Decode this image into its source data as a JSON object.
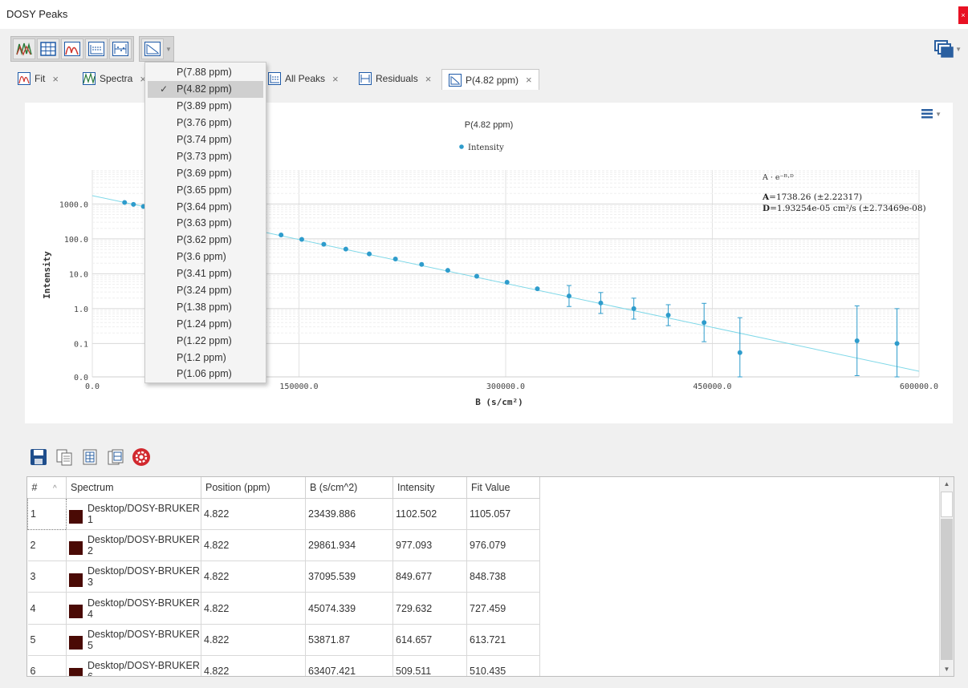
{
  "window": {
    "title": "DOSY Peaks",
    "close_label": "×"
  },
  "toolbar": {
    "buttons": [
      "spectra-view-icon",
      "table-icon",
      "fit-curve-icon",
      "all-peaks-icon",
      "residuals-icon"
    ],
    "plot_dropdown_icon": "log-plot-icon"
  },
  "tabs": [
    {
      "label": "Fit",
      "close": "×"
    },
    {
      "label": "Spectra",
      "close": "×"
    },
    {
      "label": "All Peaks",
      "close": "×"
    },
    {
      "label": "Residuals",
      "close": "×"
    },
    {
      "label": "P(4.82 ppm)",
      "close": "×",
      "active": true
    }
  ],
  "dropdown": {
    "check_mark": "✓",
    "items": [
      "P(7.88 ppm)",
      "P(4.82 ppm)",
      "P(3.89 ppm)",
      "P(3.76 ppm)",
      "P(3.74 ppm)",
      "P(3.73 ppm)",
      "P(3.69 ppm)",
      "P(3.65 ppm)",
      "P(3.64 ppm)",
      "P(3.63 ppm)",
      "P(3.62 ppm)",
      "P(3.6 ppm)",
      "P(3.41 ppm)",
      "P(3.24 ppm)",
      "P(1.38 ppm)",
      "P(1.24 ppm)",
      "P(1.22 ppm)",
      "P(1.2 ppm)",
      "P(1.06 ppm)"
    ],
    "selected_index": 1
  },
  "chart_data": {
    "type": "scatter",
    "title": "P(4.82 ppm)",
    "legend": "Intensity",
    "legend_placement": "top-center",
    "xlabel": "B (s/cm²)",
    "ylabel": "Intensity",
    "xlim": [
      0,
      600000
    ],
    "y_scale": "log",
    "grid": true,
    "x_ticks": [
      "0.0",
      "150000.0",
      "300000.0",
      "450000.0",
      "600000.0"
    ],
    "y_ticks": [
      "0.0",
      "0.1",
      "1.0",
      "10.0",
      "100.0",
      "1000.0"
    ],
    "equation": "A · e⁻ᴮ·ᴰ",
    "param_A_label": "A",
    "param_A_value": "=1738.26 (±2.22317)",
    "param_D_label": "D",
    "param_D_value": "=1.93254e-05 cm²/s (±2.73469e-08)",
    "points": [
      {
        "x": 23440,
        "y": 1102.5
      },
      {
        "x": 29862,
        "y": 977.1
      },
      {
        "x": 37096,
        "y": 849.7
      },
      {
        "x": 45074,
        "y": 729.6
      },
      {
        "x": 53872,
        "y": 614.7
      },
      {
        "x": 63407,
        "y": 509.5
      },
      {
        "x": 137000,
        "y": 130
      },
      {
        "x": 152000,
        "y": 97
      },
      {
        "x": 168000,
        "y": 70
      },
      {
        "x": 184000,
        "y": 51
      },
      {
        "x": 201000,
        "y": 37
      },
      {
        "x": 220000,
        "y": 26.5
      },
      {
        "x": 239000,
        "y": 18.5
      },
      {
        "x": 258000,
        "y": 12.5
      },
      {
        "x": 279000,
        "y": 8.5
      },
      {
        "x": 301000,
        "y": 5.7
      },
      {
        "x": 323000,
        "y": 3.7
      },
      {
        "x": 346000,
        "y": 2.3
      },
      {
        "x": 369000,
        "y": 1.45
      },
      {
        "x": 393000,
        "y": 1.0
      },
      {
        "x": 418000,
        "y": 0.65
      },
      {
        "x": 444000,
        "y": 0.4
      },
      {
        "x": 470000,
        "y": 0.055
      },
      {
        "x": 555000,
        "y": 0.12
      },
      {
        "x": 584000,
        "y": 0.1
      }
    ]
  },
  "bottom_toolbar": [
    "save-icon",
    "copy-icon",
    "table-export-icon",
    "paste-icon",
    "settings-icon"
  ],
  "table": {
    "columns": [
      "#",
      "Spectrum",
      "Position (ppm)",
      "B (s/cm^2)",
      "Intensity",
      "Fit Value"
    ],
    "sort_indicator": "^",
    "rows": [
      [
        "1",
        "Desktop/DOSY-BRUKER",
        "1",
        "4.822",
        "23439.886",
        "1102.502",
        "1105.057"
      ],
      [
        "2",
        "Desktop/DOSY-BRUKER",
        "2",
        "4.822",
        "29861.934",
        "977.093",
        "976.079"
      ],
      [
        "3",
        "Desktop/DOSY-BRUKER",
        "3",
        "4.822",
        "37095.539",
        "849.677",
        "848.738"
      ],
      [
        "4",
        "Desktop/DOSY-BRUKER",
        "4",
        "4.822",
        "45074.339",
        "729.632",
        "727.459"
      ],
      [
        "5",
        "Desktop/DOSY-BRUKER",
        "5",
        "4.822",
        "53871.87",
        "614.657",
        "613.721"
      ],
      [
        "6",
        "Desktop/DOSY-BRUKER",
        "6",
        "4.822",
        "63407.421",
        "509.511",
        "510.435"
      ]
    ]
  },
  "colors": {
    "point": "#2e9ccc",
    "fit_line": "#7fd8e8",
    "swatch": "#4a0a05"
  }
}
